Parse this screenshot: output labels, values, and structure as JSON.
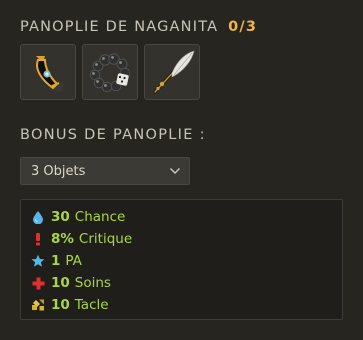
{
  "panoply": {
    "title": "PANOPLIE DE NAGANITA",
    "count": "0/3",
    "items": [
      {
        "icon": "amulet-icon"
      },
      {
        "icon": "bead-bracelet-icon"
      },
      {
        "icon": "feather-quill-icon"
      }
    ]
  },
  "bonus": {
    "title": "BONUS DE PANOPLIE :",
    "selected": "3 Objets",
    "lines": [
      {
        "icon": "water-drop-icon",
        "value": "30",
        "label": "Chance"
      },
      {
        "icon": "critical-icon",
        "value": "8%",
        "label": "Critique"
      },
      {
        "icon": "star-icon",
        "value": "1",
        "label": "PA"
      },
      {
        "icon": "heal-cross-icon",
        "value": "10",
        "label": "Soins"
      },
      {
        "icon": "tackle-icon",
        "value": "10",
        "label": "Tacle"
      }
    ]
  },
  "colors": {
    "background": "#272520",
    "accent": "#f0b548",
    "bonus_green": "#a8d645"
  }
}
